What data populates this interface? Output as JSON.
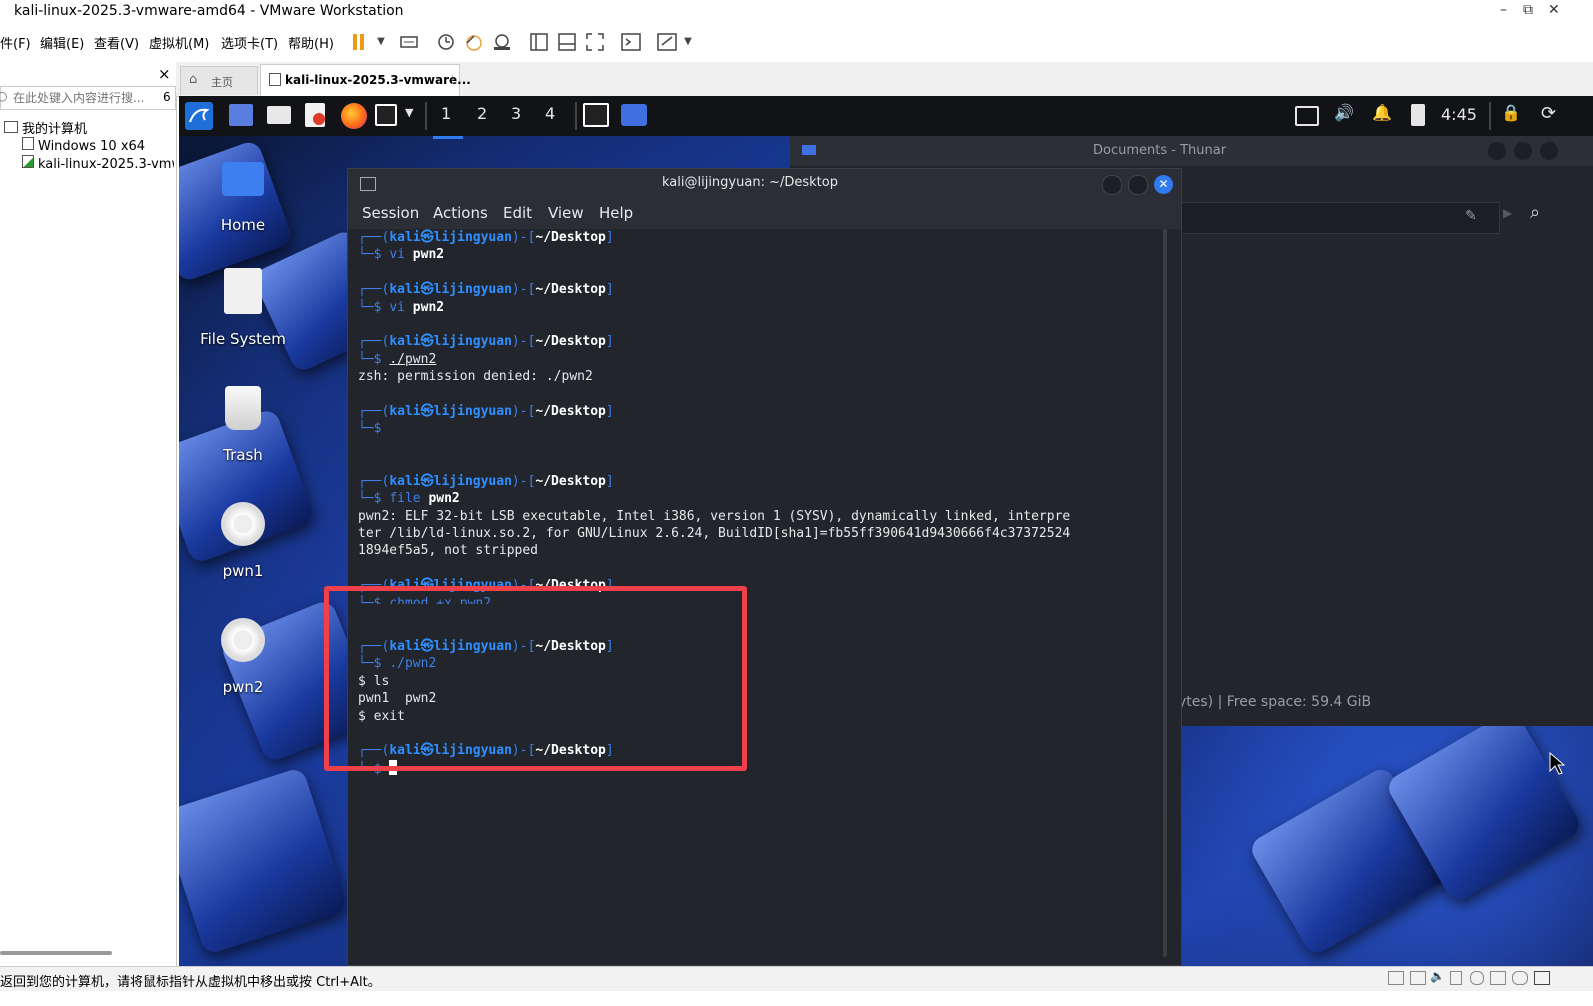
{
  "window": {
    "title": "kali-linux-2025.3-vmware-amd64 - VMware Workstation",
    "minimize": "–",
    "restore": "⧉",
    "close": "✕"
  },
  "menu": [
    "件(F)",
    "编辑(E)",
    "查看(V)",
    "虚拟机(M)",
    "选项卡(T)",
    "帮助(H)"
  ],
  "library": {
    "close": "×",
    "search_placeholder": "在此处键入内容进行搜...",
    "search_count": "6",
    "root": "我的计算机",
    "items": [
      "Windows 10 x64",
      "kali-linux-2025.3-vmw"
    ]
  },
  "tabs": [
    {
      "label": "主页"
    },
    {
      "label": "kali-linux-2025.3-vmware...",
      "close": "⋮"
    }
  ],
  "kali_panel": {
    "workspaces": [
      "1",
      "2",
      "3",
      "4"
    ],
    "clock": "4:45"
  },
  "desktop_icons": [
    "Home",
    "File System",
    "Trash",
    "pwn1",
    "pwn2"
  ],
  "thunar": {
    "title": "Documents - Thunar",
    "status": "ytes)  |  Free space: 59.4 GiB"
  },
  "terminal": {
    "title": "kali@lijingyuan: ~/Desktop",
    "menu": [
      "Session",
      "Actions",
      "Edit",
      "View",
      "Help"
    ],
    "prompt_user": "kali",
    "prompt_at": "㉿",
    "prompt_host": "lijingyuan",
    "prompt_dir": "~/Desktop",
    "cmd1": "vi",
    "cmd1_arg": "pwn2",
    "cmd2": "vi",
    "cmd2_arg": "pwn2",
    "cmd3": "./pwn2",
    "out3": "zsh: permission denied: ./pwn2",
    "cmd5": "file",
    "cmd5_arg": "pwn2",
    "out5a": "pwn2: ELF 32-bit LSB executable, Intel i386, version 1 (SYSV), dynamically linked, interpre",
    "out5b": "ter /lib/ld-linux.so.2, for GNU/Linux 2.6.24, BuildID[sha1]=fb55ff390641d9430666f4c37372524",
    "out5c": "1894ef5a5, not stripped",
    "cmd6_partial": "chmod +x pwn2",
    "cmd7": "./pwn2",
    "sh1": "$ ls",
    "sh1_out": "pwn1  pwn2",
    "sh2": "$ exit"
  },
  "statusbar": {
    "text": "返回到您的计算机，请将鼠标指针从虚拟机中移出或按 Ctrl+Alt。"
  },
  "colors": {
    "highlight": "#f0414a",
    "prompt_blue": "#2f8fff"
  }
}
